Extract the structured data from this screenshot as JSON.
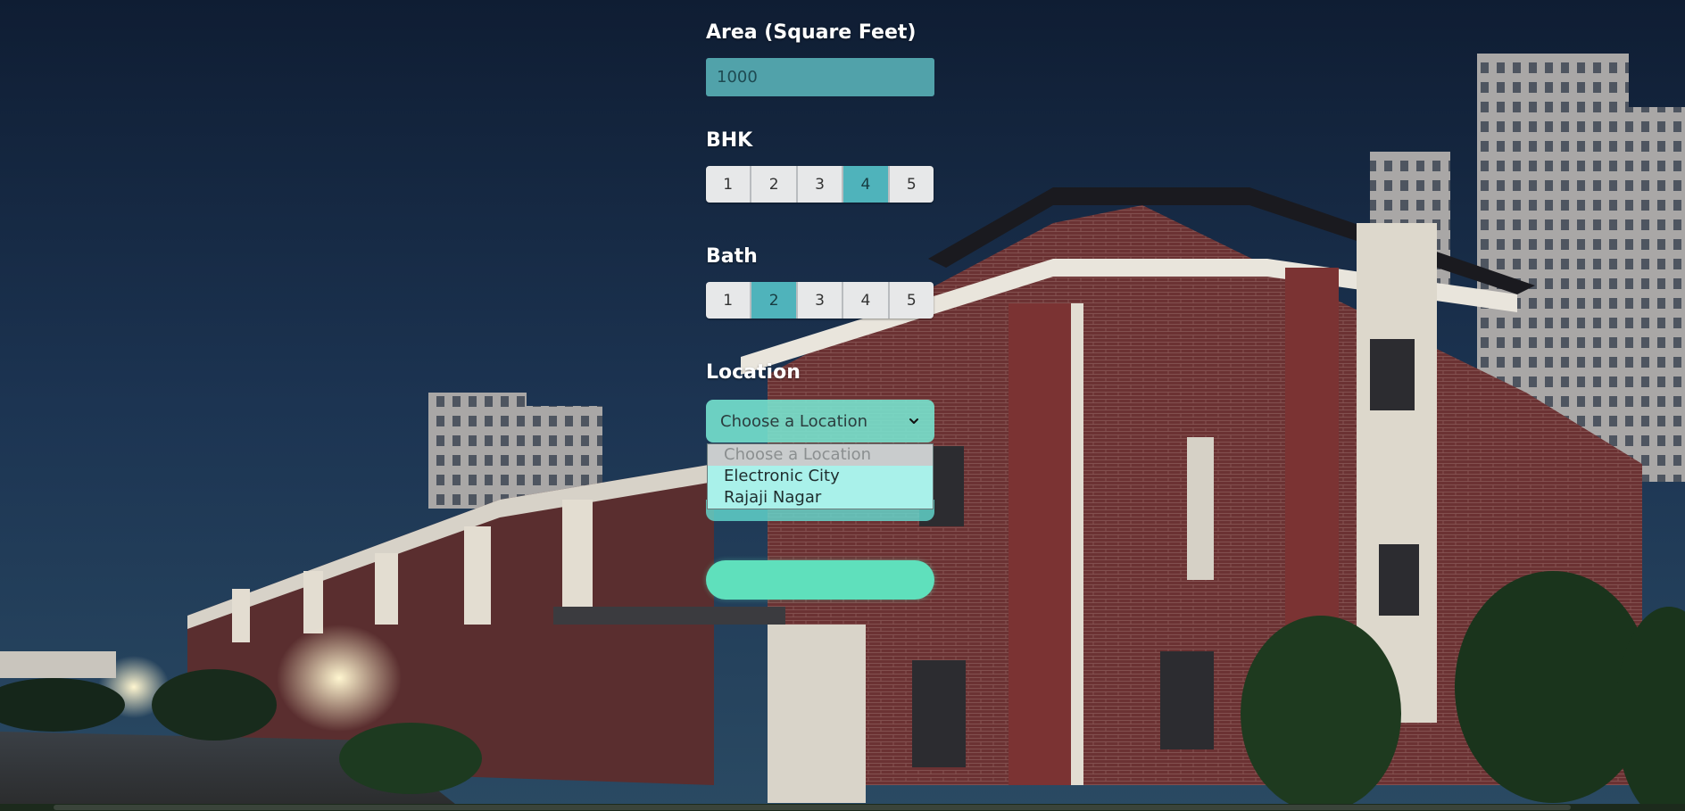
{
  "form": {
    "area": {
      "label": "Area (Square Feet)",
      "value": "1000"
    },
    "bhk": {
      "label": "BHK",
      "options": [
        "1",
        "2",
        "3",
        "4",
        "5"
      ],
      "selected": "4"
    },
    "bath": {
      "label": "Bath",
      "options": [
        "1",
        "2",
        "3",
        "4",
        "5"
      ],
      "selected": "2"
    },
    "location": {
      "label": "Location",
      "selected_value": "Choose a Location",
      "dropdown_open": true,
      "options": [
        {
          "label": "Choose a Location",
          "disabled": true
        },
        {
          "label": "Electronic City",
          "disabled": false
        },
        {
          "label": "Rajaji Nagar",
          "disabled": false
        }
      ]
    },
    "estimate_button_label": ""
  },
  "colors": {
    "input_bg": "#5ab4b9",
    "segment_active": "#4fb3bb",
    "segment_inactive": "#e7e8e9",
    "select_bg": "#78e6d2",
    "dropdown_bg": "#a9f1ea",
    "button_bg": "#5fe0bc",
    "sky_top": "#0f1e35"
  },
  "icons": {
    "select_chevron": "chevron-down-icon"
  }
}
